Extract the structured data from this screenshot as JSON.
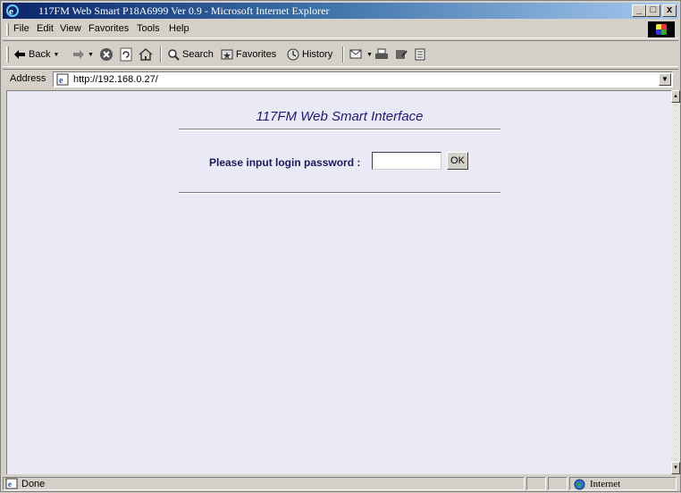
{
  "window": {
    "title": "117FM Web Smart P18A6999 Ver 0.9 - Microsoft Internet Explorer",
    "buttons": {
      "minimize": "_",
      "maximize": "□",
      "close": "x"
    }
  },
  "menu": {
    "items": [
      {
        "label": "File"
      },
      {
        "label": "Edit"
      },
      {
        "label": "View"
      },
      {
        "label": "Favorites"
      },
      {
        "label": "Tools"
      },
      {
        "label": "Help"
      }
    ]
  },
  "toolbar": {
    "back_label": "Back",
    "search_label": "Search",
    "favorites_label": "Favorites",
    "history_label": "History"
  },
  "address": {
    "label": "Address",
    "url": "http://192.168.0.27/"
  },
  "page": {
    "title": "117FM Web Smart Interface",
    "login_label": "Please input login password :",
    "password_value": "",
    "ok_label": "OK"
  },
  "status": {
    "text": "Done",
    "zone": "Internet"
  },
  "colors": {
    "title_bar_start": "#0a246a",
    "title_bar_end": "#a6caf0",
    "page_background": "#eaeaf6",
    "page_title": "#1a1a80",
    "chrome": "#d4d0c8"
  },
  "icons": [
    "ie-logo-icon",
    "back-arrow-icon",
    "forward-arrow-icon",
    "stop-icon",
    "refresh-icon",
    "home-icon",
    "search-icon",
    "favorites-icon",
    "history-icon",
    "mail-icon",
    "print-icon",
    "edit-icon",
    "discuss-icon",
    "page-icon",
    "done-icon",
    "internet-globe-icon"
  ]
}
